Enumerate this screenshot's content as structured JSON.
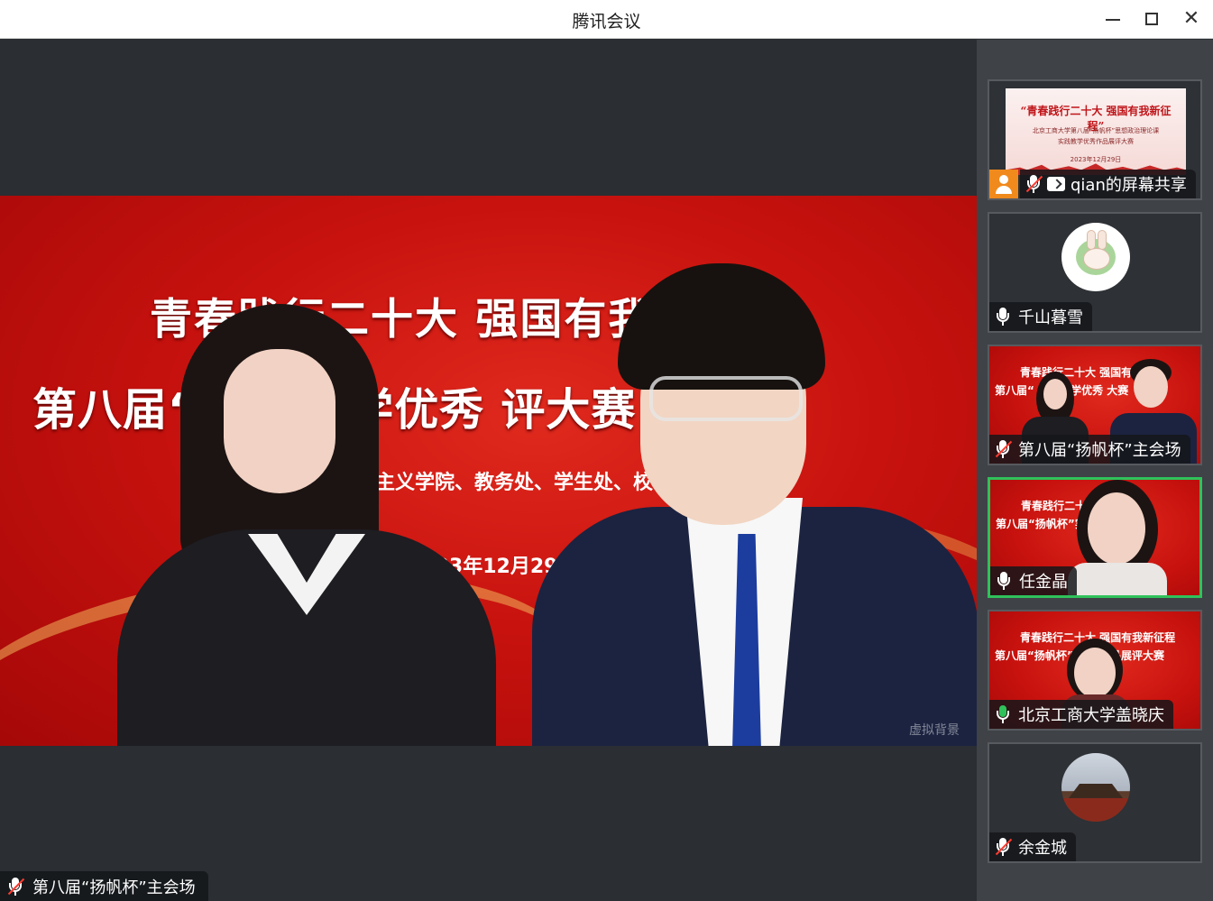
{
  "window": {
    "title": "腾讯会议",
    "minimize_label": "minimize",
    "maximize_label": "maximize",
    "close_label": "close"
  },
  "main_video": {
    "banner_line1": "青春践行二十大  强国有我",
    "banner_line2": "第八届“      实践教学优秀        评大赛",
    "banner_line3": "克思主义学院、教务处、学生处、校",
    "banner_date": "2023年12月29日",
    "watermark": "虚拟背景",
    "speaker_name": "第八届“扬帆杯”主会场",
    "speaker_muted": true
  },
  "participants": [
    {
      "name": "qian的屏幕共享",
      "type": "screen-share",
      "muted": true,
      "slide_title": "“青春践行二十大 强国有我新征程”",
      "slide_line2": "北京工商大学第八届“扬帆杯”思想政治理论课",
      "slide_line3": "实践教学优秀作品展评大赛",
      "slide_date": "2023年12月29日"
    },
    {
      "name": "千山暮雪",
      "type": "avatar",
      "muted": false,
      "avatar": "bunny-avatar"
    },
    {
      "name": "第八届“扬帆杯”主会场",
      "type": "video",
      "muted": true,
      "mini_t1": "青春践行二十大  强国有我",
      "mini_t2": "第八届“        实践教学优秀        大赛"
    },
    {
      "name": "任金晶",
      "type": "video",
      "muted": false,
      "active": true,
      "mini_t1": "青春践行二十     程",
      "mini_t2": "第八届“扬帆杯”实          展评大赛"
    },
    {
      "name": "北京工商大学盖晓庆",
      "type": "video",
      "muted": false,
      "mini_t1": "青春践行二十大 强国有我新征程",
      "mini_t2": "第八届“扬帆杯”        优秀作品展评大赛"
    },
    {
      "name": "余金城",
      "type": "avatar",
      "muted": true,
      "avatar": "city-gate-avatar"
    }
  ],
  "colors": {
    "active_speaker_border": "#2fc25b",
    "muted_icon": "#ff3b30",
    "share_badge": "#f08a1c",
    "banner_red": "#c8120e"
  }
}
